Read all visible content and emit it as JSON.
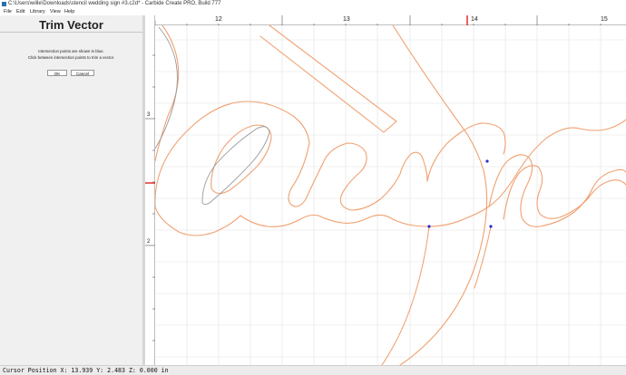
{
  "window": {
    "title": "C:\\Users\\wille\\Downloads\\stencil wedding sign #3.c2d* - Carbide Create PRO, Build 777"
  },
  "menu": {
    "items": [
      "File",
      "Edit",
      "Library",
      "View",
      "Help"
    ]
  },
  "panel": {
    "title": "Trim Vector",
    "instruction_1": "Intersection points are shown in blue.",
    "instruction_2": "Click between intersection points to trim a vector.",
    "ok_label": "OK",
    "cancel_label": "Cancel"
  },
  "rulers": {
    "horizontal_labels": [
      "12",
      "13",
      "14",
      "15"
    ],
    "vertical_labels": [
      "3",
      "2"
    ]
  },
  "status": {
    "cursor_position": "Cursor Position X: 13.939 Y: 2.483 Z: 0.000 in"
  },
  "colors": {
    "vector_orange": "#f0a070",
    "selected_vector": "#999999",
    "intersection_blue": "#2a2ad0",
    "cursor_marker_red": "#e02020",
    "grid_line": "#e2e2e2"
  }
}
